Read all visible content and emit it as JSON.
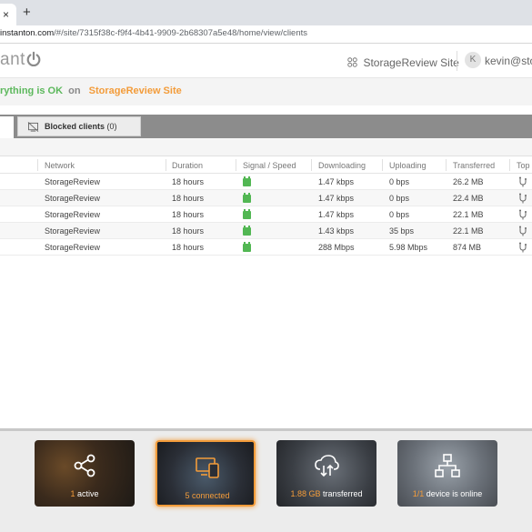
{
  "browser": {
    "tab_close": "×",
    "new_tab": "+",
    "url_host": "instanton.com",
    "url_path": "/#/site/7315f38c-f9f4-4b41-9909-2b68307a5e48/home/view/clients"
  },
  "header": {
    "logo_text": "ant",
    "site_name": "StorageReview Site",
    "user_initial": "K",
    "user_name": "kevin@sto"
  },
  "status": {
    "text": "rything is OK",
    "on": "on",
    "site": "StorageReview Site"
  },
  "tabs": {
    "blocked_label": "Blocked clients",
    "blocked_count": "(0)"
  },
  "table": {
    "columns": [
      "Network",
      "Duration",
      "Signal / Speed",
      "Downloading",
      "Uploading",
      "Transferred",
      "Top"
    ],
    "rows": [
      {
        "network": "StorageReview",
        "duration": "18 hours",
        "downloading": "1.47 kbps",
        "uploading": "0 bps",
        "transferred": "26.2 MB"
      },
      {
        "network": "StorageReview",
        "duration": "18 hours",
        "downloading": "1.47 kbps",
        "uploading": "0 bps",
        "transferred": "22.4 MB"
      },
      {
        "network": "StorageReview",
        "duration": "18 hours",
        "downloading": "1.47 kbps",
        "uploading": "0 bps",
        "transferred": "22.1 MB"
      },
      {
        "network": "StorageReview",
        "duration": "18 hours",
        "downloading": "1.43 kbps",
        "uploading": "35 bps",
        "transferred": "22.1 MB"
      },
      {
        "network": "StorageReview",
        "duration": "18 hours",
        "downloading": "288 Mbps",
        "uploading": "5.98 Mbps",
        "transferred": "874 MB"
      }
    ]
  },
  "cards": {
    "active": {
      "num": "1",
      "label": "active"
    },
    "connected": {
      "num": "5",
      "label": "connected"
    },
    "transferred": {
      "num": "1.88 GB",
      "label": "transferred"
    },
    "device": {
      "num": "1/1",
      "label": "device is online"
    }
  },
  "colors": {
    "ok_green": "#5cb85c",
    "accent_orange": "#f39c3a",
    "signal_green": "#52b753"
  },
  "icons": [
    "power-logo-icon",
    "sites-grid-icon",
    "blocked-device-icon",
    "signal-icon",
    "topology-icon",
    "share-network-icon",
    "devices-icon",
    "cloud-transfer-icon",
    "network-device-icon"
  ]
}
